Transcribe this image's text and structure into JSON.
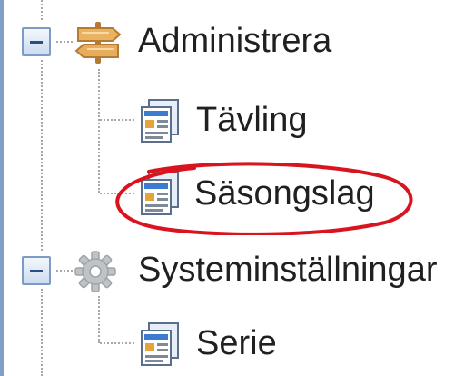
{
  "tree": {
    "items": [
      {
        "label": "Administrera",
        "icon": "signpost-icon",
        "expanded": true
      },
      {
        "label": "Tävling",
        "icon": "document-icon"
      },
      {
        "label": "Säsongslag",
        "icon": "document-icon",
        "annotated": true
      },
      {
        "label": "Systeminställningar",
        "icon": "gear-icon",
        "expanded": true
      },
      {
        "label": "Serie",
        "icon": "document-icon"
      }
    ]
  },
  "colors": {
    "annotation": "#d9141e",
    "expander_border": "#7c9cc5",
    "tree_line": "#a8a8a8",
    "left_border": "#7f9fc7"
  }
}
